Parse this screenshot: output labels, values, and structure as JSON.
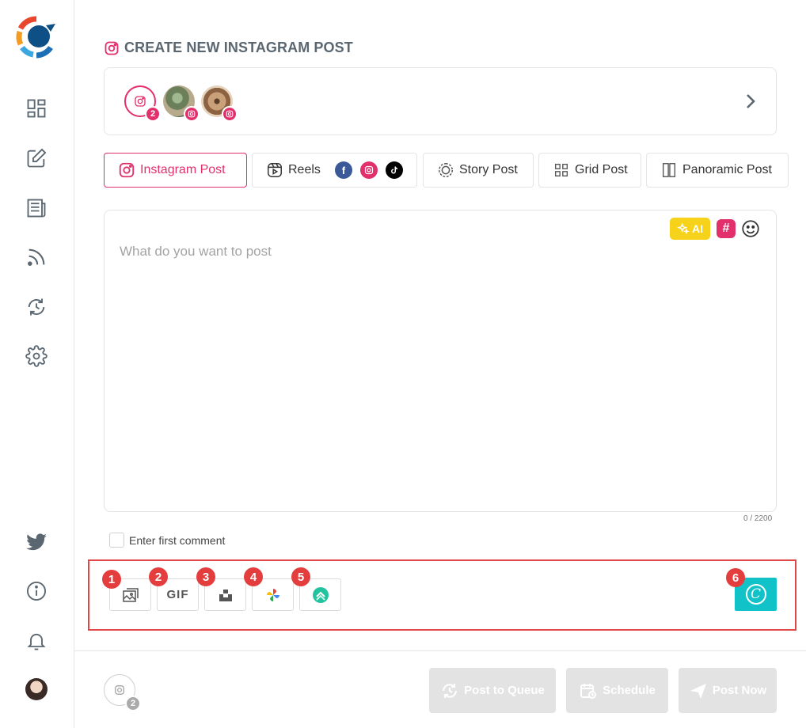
{
  "page": {
    "title": "CREATE NEW INSTAGRAM POST"
  },
  "accounts": {
    "selected_count": "2"
  },
  "tabs": [
    {
      "label": "Instagram Post",
      "active": true
    },
    {
      "label": "Reels",
      "platforms": [
        "f",
        "ig",
        "tiktok"
      ]
    },
    {
      "label": "Story Post"
    },
    {
      "label": "Grid Post"
    },
    {
      "label": "Panoramic Post"
    }
  ],
  "editor": {
    "placeholder": "What do you want to post",
    "ai_label": "AI",
    "hashtag_label": "#",
    "char_count": "0 / 2200"
  },
  "comment": {
    "label": "Enter first comment"
  },
  "media_toolbar": {
    "badges": [
      "1",
      "2",
      "3",
      "4",
      "5",
      "6"
    ],
    "gif_label": "GIF",
    "canva_label": "C"
  },
  "footer": {
    "account_count": "2",
    "queue_label": "Post to Queue",
    "schedule_label": "Schedule",
    "post_now_label": "Post Now"
  },
  "colors": {
    "instagram": "#e1306c",
    "ai": "#f7d21a",
    "canva": "#12c2c9",
    "highlight": "#e04848",
    "disabled_button": "#e3e3e3"
  }
}
